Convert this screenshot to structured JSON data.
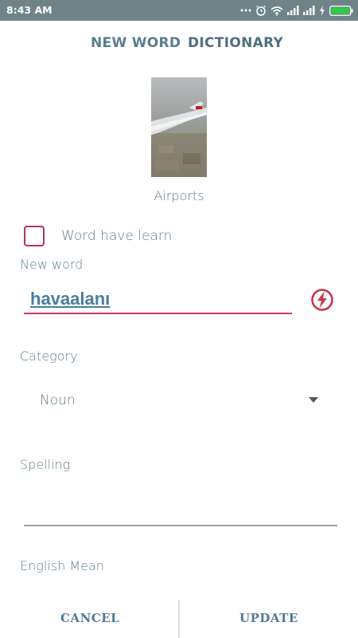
{
  "status_bar": {
    "time": "8:43 AM",
    "icons": [
      "more-icon",
      "alarm-icon",
      "wifi-icon",
      "signal-icon",
      "signal-icon",
      "charging-icon",
      "battery-icon"
    ]
  },
  "tabs": [
    {
      "label": "NEW WORD"
    },
    {
      "label": "DICTIONARY"
    }
  ],
  "picture": {
    "caption": "Airports",
    "description_icon": "airplane-window-photo"
  },
  "learned_checkbox": {
    "label": "Word have learn",
    "checked": false
  },
  "new_word": {
    "label": "New word",
    "value": "havaalanı"
  },
  "category": {
    "label": "Category",
    "selected": "Noun"
  },
  "spelling": {
    "label": "Spelling",
    "value": ""
  },
  "english_mean": {
    "label": "English Mean"
  },
  "buttons": {
    "cancel": "CANCEL",
    "update": "UPDATE"
  },
  "colors": {
    "accent": "#d4336b",
    "checkbox": "#b2345e",
    "text": "#5e7f8f",
    "status_bar": "#6f8389"
  }
}
